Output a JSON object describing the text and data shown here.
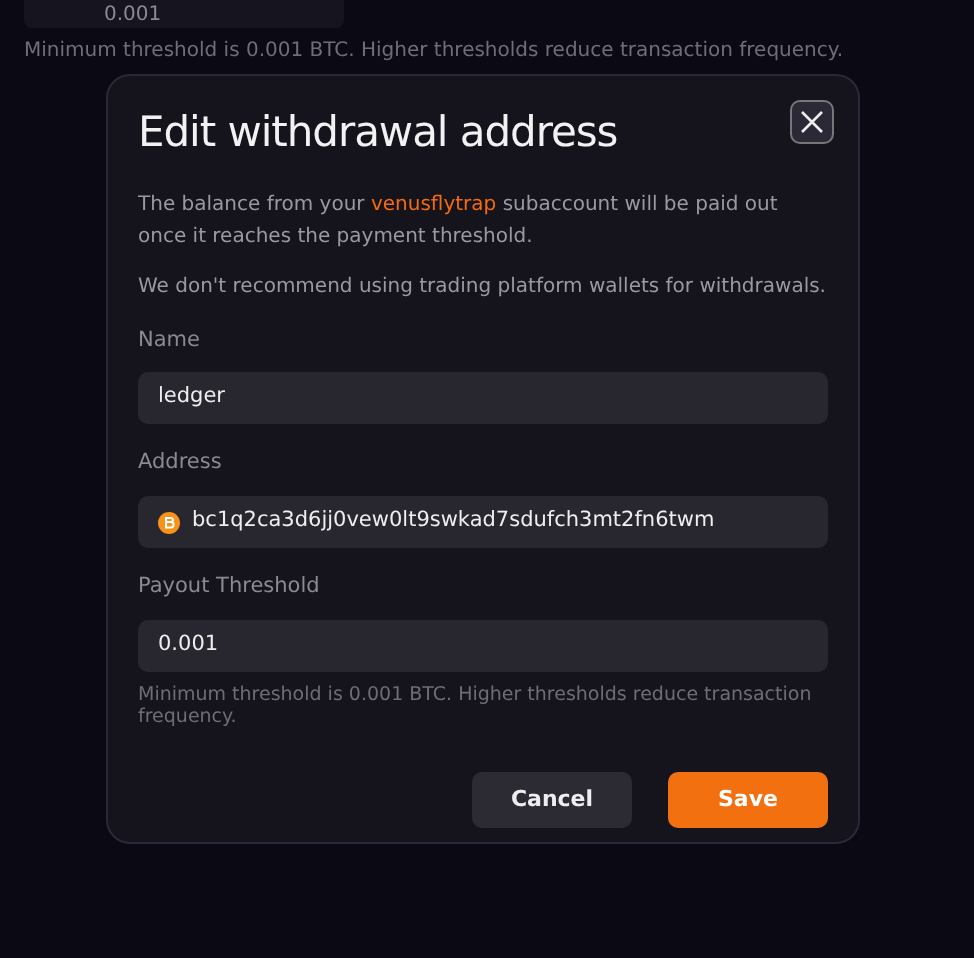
{
  "background": {
    "threshold_value": "0.001",
    "hint": "Minimum threshold is 0.001 BTC. Higher thresholds reduce transaction frequency."
  },
  "dialog": {
    "title": "Edit withdrawal address",
    "intro": "The balance from your ",
    "subaccount": "venusflytrap",
    "intro_end": " subaccount will be paid out once it reaches the payment threshold.",
    "warning": "We don't recommend using trading platform wallets for withdrawals.",
    "fields": [
      {
        "kind": "text",
        "label": "Name",
        "value": "ledger"
      },
      {
        "kind": "address",
        "label": "Address",
        "value": "bc1q2ca3d6jj0vew0lt9swkad7sdufch3mt2fn6twm"
      },
      {
        "kind": "text",
        "label": "Payout Threshold",
        "value": "0.001",
        "hint": "Minimum threshold is 0.001 BTC. Higher thresholds reduce transaction frequency."
      }
    ],
    "buttons": [
      {
        "kind": "secondary",
        "label": "Cancel"
      },
      {
        "kind": "primary",
        "label": "Save"
      }
    ]
  }
}
